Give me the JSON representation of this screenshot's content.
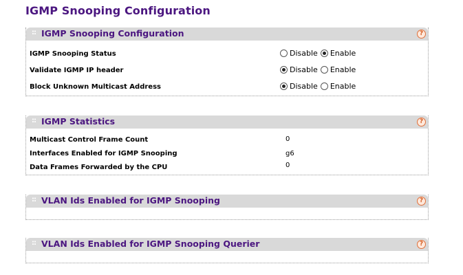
{
  "page_title": "IGMP Snooping Configuration",
  "config_panel": {
    "title": "IGMP Snooping Configuration",
    "rows": [
      {
        "label": "IGMP Snooping Status",
        "options": [
          "Disable",
          "Enable"
        ],
        "selected": "Enable"
      },
      {
        "label": "Validate IGMP IP header",
        "options": [
          "Disable",
          "Enable"
        ],
        "selected": "Disable"
      },
      {
        "label": "Block Unknown Multicast Address",
        "options": [
          "Disable",
          "Enable"
        ],
        "selected": "Disable"
      }
    ]
  },
  "stats_panel": {
    "title": "IGMP Statistics",
    "rows": [
      {
        "label": "Multicast Control Frame Count",
        "value": "0"
      },
      {
        "label": "Interfaces Enabled for IGMP Snooping",
        "value": "g6"
      },
      {
        "label": "Data Frames Forwarded by the CPU",
        "value": "0"
      }
    ]
  },
  "vlan_panel": {
    "title": "VLAN Ids Enabled for IGMP Snooping"
  },
  "querier_panel": {
    "title": "VLAN Ids Enabled for IGMP Snooping Querier"
  },
  "icons": {
    "grip": "grip-icon",
    "help": "help-icon"
  },
  "colors": {
    "title": "#4b1680",
    "header_bg": "#d9d9d9",
    "help_accent": "#e0703a"
  }
}
